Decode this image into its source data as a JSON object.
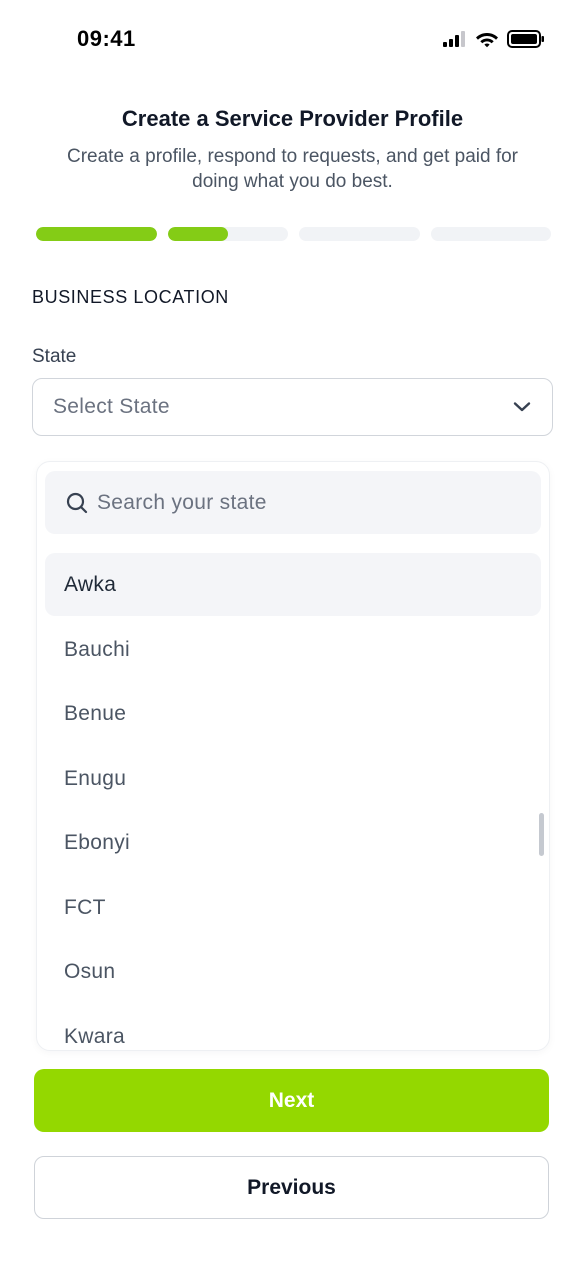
{
  "status_bar": {
    "time": "09:41"
  },
  "header": {
    "title": "Create a Service Provider Profile",
    "subtitle": "Create a profile, respond to requests, and get paid for doing what you do best."
  },
  "progress": {
    "steps": [
      {
        "fill": 1.0
      },
      {
        "fill": 0.5
      },
      {
        "fill": 0.0
      },
      {
        "fill": 0.0
      }
    ],
    "accent_color": "#84cc16"
  },
  "form": {
    "section_label": "BUSINESS LOCATION",
    "state_label": "State",
    "state_select": {
      "placeholder": "Select State",
      "icon": "chevron-down-icon"
    }
  },
  "dropdown": {
    "search_placeholder": "Search your state",
    "search_icon": "search-icon",
    "options": [
      "Awka",
      "Bauchi",
      "Benue",
      "Enugu",
      "Ebonyi",
      "FCT",
      "Osun",
      "Kwara"
    ],
    "selected_index": 0
  },
  "actions": {
    "next_label": "Next",
    "previous_label": "Previous",
    "next_color": "#94d800"
  }
}
